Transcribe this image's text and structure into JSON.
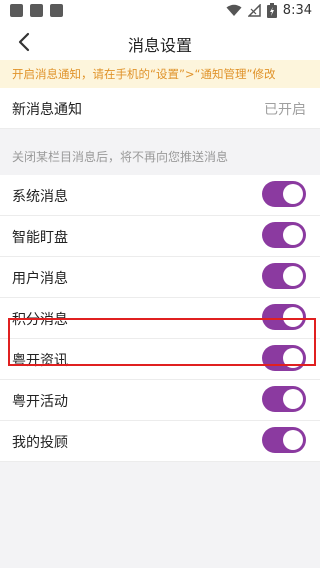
{
  "status_bar": {
    "time": "8:34"
  },
  "nav": {
    "title": "消息设置"
  },
  "tip": {
    "text": "开启消息通知，请在手机的“设置”>“通知管理”修改"
  },
  "notification": {
    "label": "新消息通知",
    "value": "已开启"
  },
  "section": {
    "label": "关闭某栏目消息后，将不再向您推送消息"
  },
  "items": [
    {
      "label": "系统消息",
      "on": true
    },
    {
      "label": "智能盯盘",
      "on": true
    },
    {
      "label": "用户消息",
      "on": true
    },
    {
      "label": "积分消息",
      "on": true
    },
    {
      "label": "粤开资讯",
      "on": true
    },
    {
      "label": "粤开活动",
      "on": true
    },
    {
      "label": "我的投顾",
      "on": true
    }
  ],
  "colors": {
    "toggle_on": "#8b3aa0",
    "tip_text": "#e0932b",
    "tip_bg": "#fdf5dc",
    "highlight": "#e02020"
  }
}
